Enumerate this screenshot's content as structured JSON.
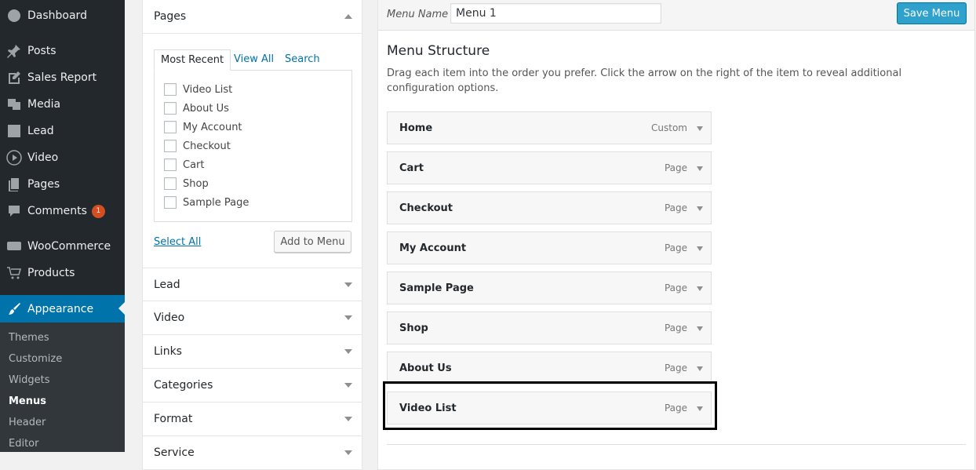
{
  "sidebar": {
    "items": [
      {
        "label": "Dashboard",
        "icon": "dashboard-icon"
      },
      {
        "label": "Posts",
        "icon": "pin-icon"
      },
      {
        "label": "Sales Report",
        "icon": "edit-icon"
      },
      {
        "label": "Media",
        "icon": "media-icon"
      },
      {
        "label": "Lead",
        "icon": "lead-icon"
      },
      {
        "label": "Video",
        "icon": "youtube-icon"
      },
      {
        "label": "Pages",
        "icon": "pages-icon"
      },
      {
        "label": "Comments",
        "icon": "comment-icon",
        "badge": "1"
      },
      {
        "label": "WooCommerce",
        "icon": "woocommerce-icon"
      },
      {
        "label": "Products",
        "icon": "cart-icon"
      },
      {
        "label": "Appearance",
        "icon": "brush-icon"
      }
    ],
    "submenu": [
      "Themes",
      "Customize",
      "Widgets",
      "Menus",
      "Header",
      "Editor"
    ],
    "current_submenu": "Menus"
  },
  "pages_box": {
    "title": "Pages",
    "tabs": [
      "Most Recent",
      "View All",
      "Search"
    ],
    "checkboxes": [
      "Video List",
      "About Us",
      "My Account",
      "Checkout",
      "Cart",
      "Shop",
      "Sample Page"
    ],
    "select_all": "Select All",
    "add_to_menu": "Add to Menu"
  },
  "accordion": [
    "Lead",
    "Video",
    "Links",
    "Categories",
    "Format",
    "Service"
  ],
  "menu_edit": {
    "name_label": "Menu Name",
    "name_value": "Menu 1",
    "save_label": "Save Menu",
    "structure_title": "Menu Structure",
    "structure_desc": "Drag each item into the order you prefer. Click the arrow on the right of the item to reveal additional configuration options.",
    "items": [
      {
        "title": "Home",
        "type": "Custom"
      },
      {
        "title": "Cart",
        "type": "Page"
      },
      {
        "title": "Checkout",
        "type": "Page"
      },
      {
        "title": "My Account",
        "type": "Page"
      },
      {
        "title": "Sample Page",
        "type": "Page"
      },
      {
        "title": "Shop",
        "type": "Page"
      },
      {
        "title": "About Us",
        "type": "Page"
      },
      {
        "title": "Video List",
        "type": "Page"
      }
    ]
  },
  "colors": {
    "sidebar_bg": "#23282d",
    "active": "#0073aa",
    "primary_button": "#2ea2cc",
    "badge": "#d54e21"
  }
}
